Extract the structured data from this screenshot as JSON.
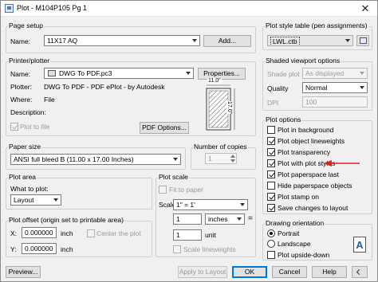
{
  "window": {
    "title": "Plot - M104P105 Pg 1",
    "close_glyph": "✕"
  },
  "page_setup": {
    "group_label": "Page setup",
    "name_label": "Name:",
    "name_value": "11X17 AQ",
    "add_button": "Add..."
  },
  "printer": {
    "group_label": "Printer/plotter",
    "name_label": "Name:",
    "name_value": "DWG To PDF.pc3",
    "properties_button": "Properties...",
    "plotter_label": "Plotter:",
    "plotter_value": "DWG To PDF - PDF ePlot - by Autodesk",
    "where_label": "Where:",
    "where_value": "File",
    "description_label": "Description:",
    "plot_to_file_label": "Plot to file",
    "pdf_options_button": "PDF Options...",
    "preview_width": "11.0\"",
    "preview_height": "17.0\""
  },
  "paper_size": {
    "group_label": "Paper size",
    "value": "ANSI full bleed B (11.00 x 17.00 Inches)"
  },
  "copies": {
    "label": "Number of copies",
    "value": "1"
  },
  "plot_area": {
    "group_label": "Plot area",
    "what_label": "What to plot:",
    "what_value": "Layout"
  },
  "plot_scale": {
    "group_label": "Plot scale",
    "fit_label": "Fit to paper",
    "scale_label": "Scale:",
    "scale_value": "1\" = 1'",
    "value1": "1",
    "units": "inches",
    "equals": "=",
    "value2": "1",
    "unit_label": "unit",
    "lineweights_label": "Scale lineweights"
  },
  "plot_offset": {
    "group_label": "Plot offset (origin set to printable area)",
    "x_label": "X:",
    "x_value": "0.000000",
    "x_unit": "inch",
    "center_label": "Center the plot",
    "y_label": "Y:",
    "y_value": "0.000000",
    "y_unit": "inch"
  },
  "buttons": {
    "preview": "Preview...",
    "apply": "Apply to Layout",
    "ok": "OK",
    "cancel": "Cancel",
    "help": "Help"
  },
  "plot_style_table": {
    "group_label": "Plot style table (pen assignments)",
    "value": "LWL.ctb"
  },
  "shaded_viewport": {
    "group_label": "Shaded viewport options",
    "shade_label": "Shade plot",
    "shade_value": "As displayed",
    "quality_label": "Quality",
    "quality_value": "Normal",
    "dpi_label": "DPI",
    "dpi_value": "100"
  },
  "plot_options": {
    "group_label": "Plot options",
    "items": [
      {
        "label": "Plot in background",
        "checked": false
      },
      {
        "label": "Plot object lineweights",
        "checked": true
      },
      {
        "label": "Plot transparency",
        "checked": true
      },
      {
        "label": "Plot with plot styles",
        "checked": true
      },
      {
        "label": "Plot paperspace last",
        "checked": true
      },
      {
        "label": "Hide paperspace objects",
        "checked": false
      },
      {
        "label": "Plot stamp on",
        "checked": true
      },
      {
        "label": "Save changes to layout",
        "checked": true
      }
    ],
    "annotation_arrow_color": "#e02020"
  },
  "drawing_orientation": {
    "group_label": "Drawing orientation",
    "portrait_label": "Portrait",
    "landscape_label": "Landscape",
    "upside_down_label": "Plot upside-down",
    "orientation_glyph": "A"
  }
}
